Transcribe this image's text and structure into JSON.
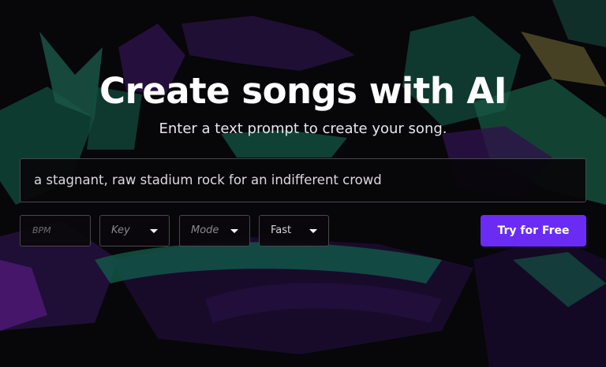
{
  "hero": {
    "title": "Create songs with AI",
    "subtitle": "Enter a text prompt to create your song."
  },
  "prompt_input": {
    "value": "a stagnant, raw stadium rock for an indifferent crowd"
  },
  "controls": {
    "bpm_placeholder": "BPM",
    "key_placeholder": "Key",
    "mode_placeholder": "Mode",
    "speed_value": "Fast"
  },
  "cta": {
    "label": "Try for Free"
  },
  "colors": {
    "accent": "#6a2cf5",
    "background": "#0d0a10",
    "art_green": "#1f9a7a",
    "art_purple": "#4a1f78",
    "art_yellow": "#c7b85a"
  },
  "icons": {
    "dropdown": "caret-down-icon"
  }
}
